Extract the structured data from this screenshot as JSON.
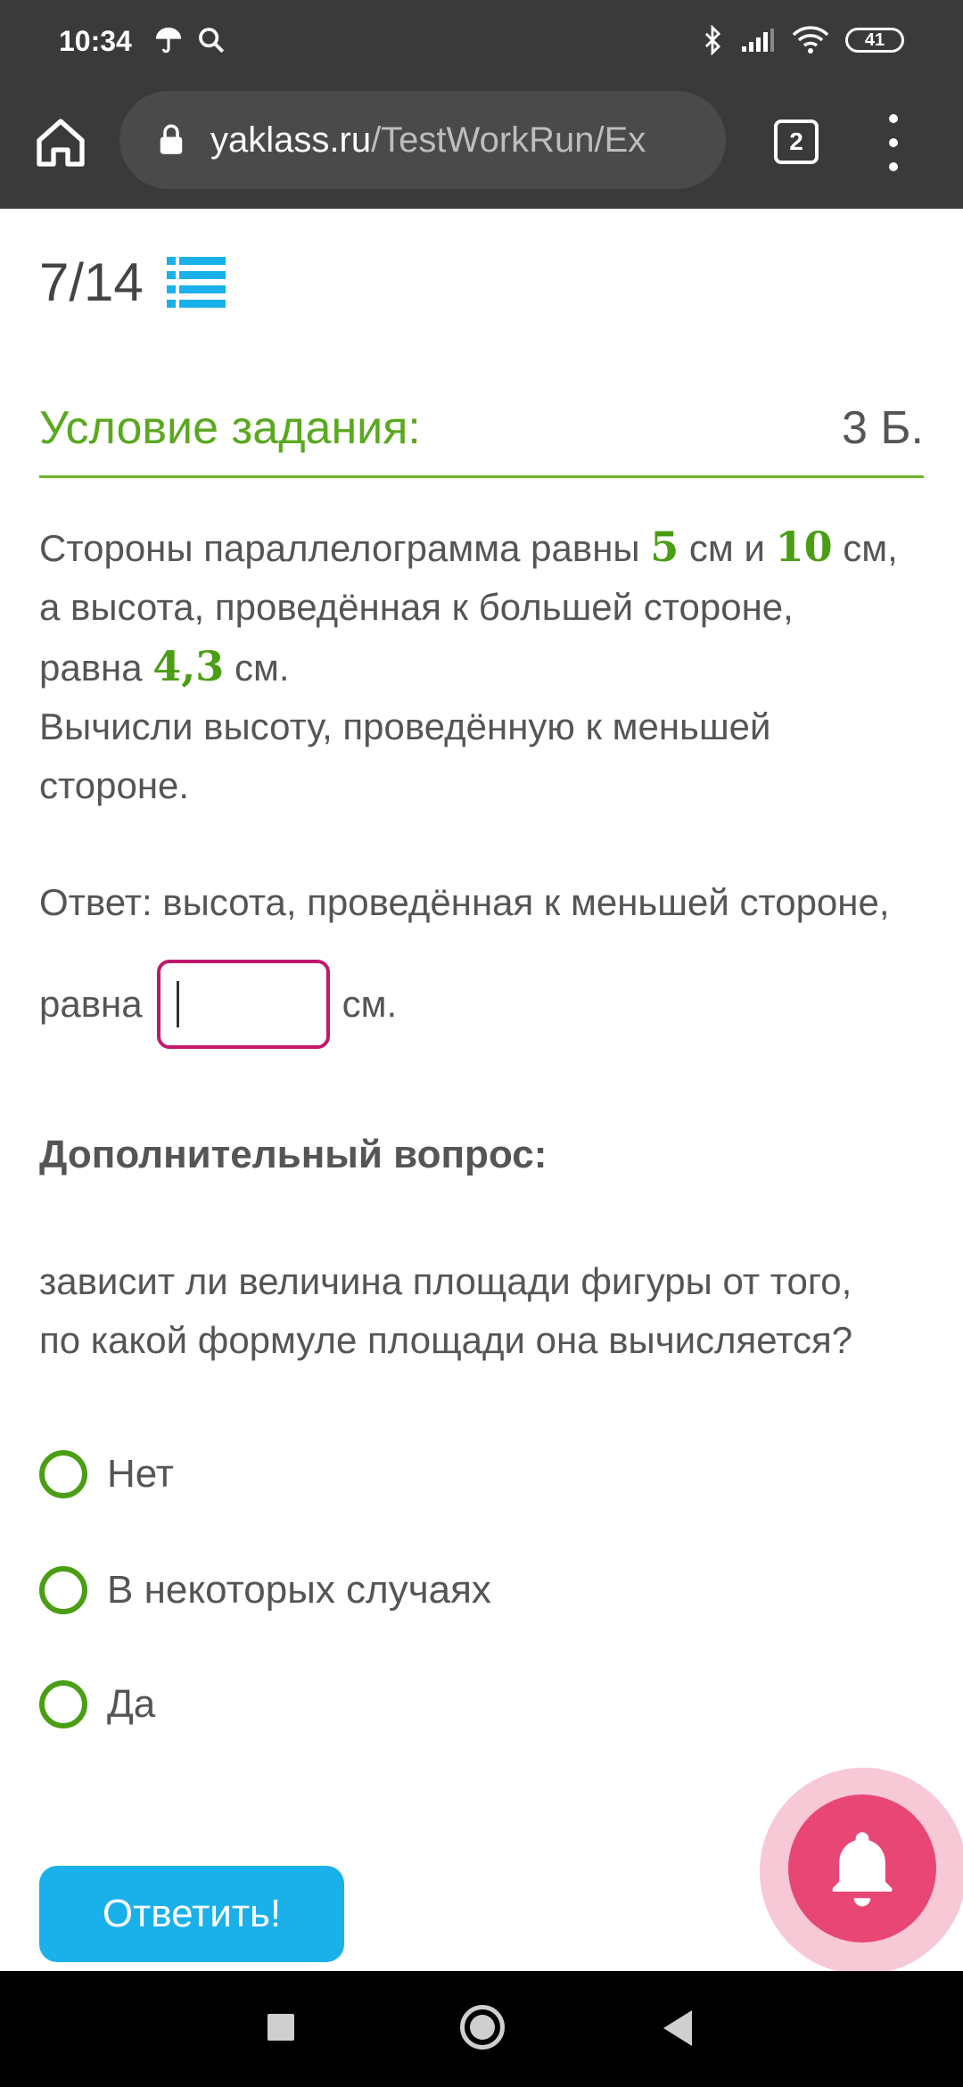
{
  "status_bar": {
    "time": "10:34",
    "battery": "41",
    "icons": [
      "umbrella-icon",
      "search-icon",
      "bluetooth-icon",
      "signal-icon",
      "wifi-icon",
      "battery-icon"
    ]
  },
  "browser": {
    "url_domain": "yaklass.ru",
    "url_path": "/TestWorkRun/Ex",
    "tab_count": "2"
  },
  "progress": {
    "text": "7/14"
  },
  "task": {
    "title": "Условие задания:",
    "points": "3 Б.",
    "q_part1": "Стороны параллелограмма равны ",
    "q_num1": "5",
    "q_part2": " см и ",
    "q_num2": "10",
    "q_part3": " см,",
    "q_part4": "а высота, проведённая к большей стороне,",
    "q_part5": "равна ",
    "q_num3": "4,3",
    "q_part6": " см.",
    "q_part7": "Вычисли высоту, проведённую к меньшей",
    "q_part8": "стороне."
  },
  "answer": {
    "line1": "Ответ: высота, проведённая к меньшей стороне,",
    "prefix": "равна",
    "value": "",
    "suffix": "см."
  },
  "extra": {
    "title": "Дополнительный вопрос:",
    "question_line1": "зависит ли величина площади фигуры от того,",
    "question_line2": "по какой формуле площади она вычисляется?",
    "options": [
      {
        "label": "Нет"
      },
      {
        "label": "В некоторых случаях"
      },
      {
        "label": "Да"
      }
    ]
  },
  "submit_label": "Ответить!",
  "colors": {
    "accent_green": "#5aa81f",
    "input_border": "#c2186a",
    "submit_blue": "#1ab0ea",
    "bell_pink": "#e84776"
  }
}
